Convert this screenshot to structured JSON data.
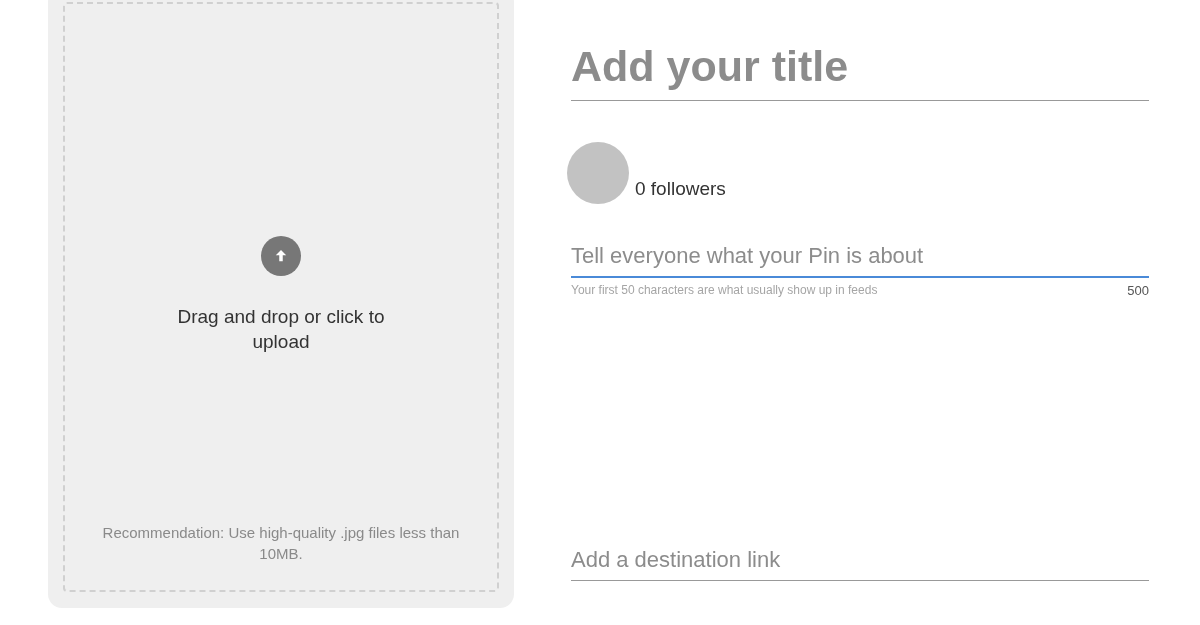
{
  "upload": {
    "prompt": "Drag and drop or click to upload",
    "recommendation": "Recommendation: Use high-quality .jpg files less than 10MB."
  },
  "title_field": {
    "placeholder": "Add your title",
    "focused": false
  },
  "profile": {
    "followers": "0 followers"
  },
  "description_field": {
    "placeholder": "Tell everyone what your Pin is about",
    "focused": true,
    "hint": "Your first 50 characters are what usually show up in feeds",
    "counter": "500"
  },
  "link_field": {
    "placeholder": "Add a destination link",
    "focused": false
  }
}
